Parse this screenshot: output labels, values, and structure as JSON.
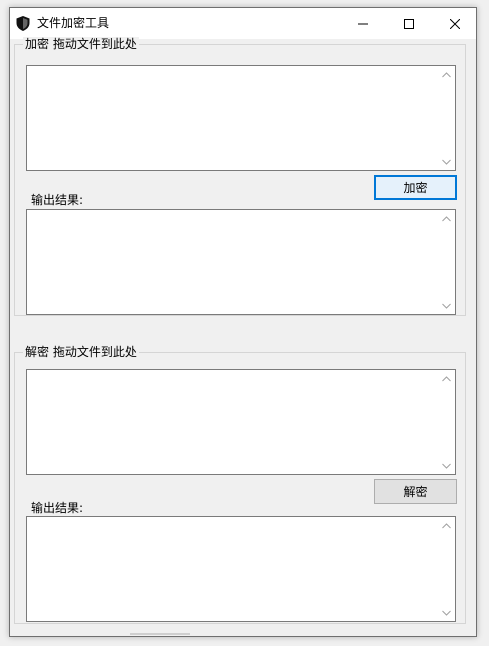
{
  "window": {
    "title": "文件加密工具",
    "icon": "shield-icon",
    "controls": {
      "minimize": "minimize-icon",
      "maximize": "maximize-icon",
      "close": "close-icon"
    }
  },
  "encrypt": {
    "group_title": "加密  拖动文件到此处",
    "input_text": "",
    "button_label": "加密",
    "output_label": "输出结果:",
    "output_text": ""
  },
  "decrypt": {
    "group_title": "解密  拖动文件到此处",
    "input_text": "",
    "button_label": "解密",
    "output_label": "输出结果:",
    "output_text": ""
  },
  "colors": {
    "accent": "#0078d7",
    "window_bg": "#f0f0f0",
    "text": "#000000"
  }
}
